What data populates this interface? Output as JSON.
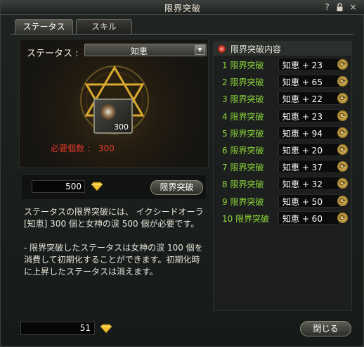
{
  "window": {
    "title": "限界突破",
    "help_icon": "?",
    "lock_icon": "lock-icon",
    "close_icon": "×"
  },
  "tabs": [
    {
      "label": "ステータス",
      "active": true
    },
    {
      "label": "スキル",
      "active": false
    }
  ],
  "status": {
    "label": "ステータス :",
    "selected": "知恵",
    "dropdown_icon": "▼"
  },
  "item": {
    "count": "300",
    "required_label": "必要個数 :",
    "required_value": "300"
  },
  "action": {
    "amount": "500",
    "break_button": "限界突破"
  },
  "description": {
    "paragraph1": "ステータスの限界突破には、 イクシードオーラ[知恵] 300 個と女神の涙 500 個が必要です。",
    "paragraph2": "- 限界突破したステータスは女神の涙 100 個を消費して初期化することができます。初期化時に上昇したステータスは消えます。"
  },
  "breakthrough_panel": {
    "title": "限界突破内容",
    "rows": [
      {
        "step": "1 限界突破",
        "value": "知恵 + 23"
      },
      {
        "step": "2 限界突破",
        "value": "知恵 + 65"
      },
      {
        "step": "3 限界突破",
        "value": "知恵 + 22"
      },
      {
        "step": "4 限界突破",
        "value": "知恵 + 23"
      },
      {
        "step": "5 限界突破",
        "value": "知恵 + 94"
      },
      {
        "step": "6 限界突破",
        "value": "知恵 + 20"
      },
      {
        "step": "7 限界突破",
        "value": "知恵 + 37"
      },
      {
        "step": "8 限界突破",
        "value": "知恵 + 32"
      },
      {
        "step": "9 限界突破",
        "value": "知恵 + 50"
      },
      {
        "step": "10 限界突破",
        "value": "知恵 + 60"
      }
    ]
  },
  "footer": {
    "currency": "51",
    "close_button": "閉じる"
  },
  "colors": {
    "step_green": "#8ed63a",
    "required_red": "#e03a2a",
    "gem_gold": "#f2c230"
  }
}
